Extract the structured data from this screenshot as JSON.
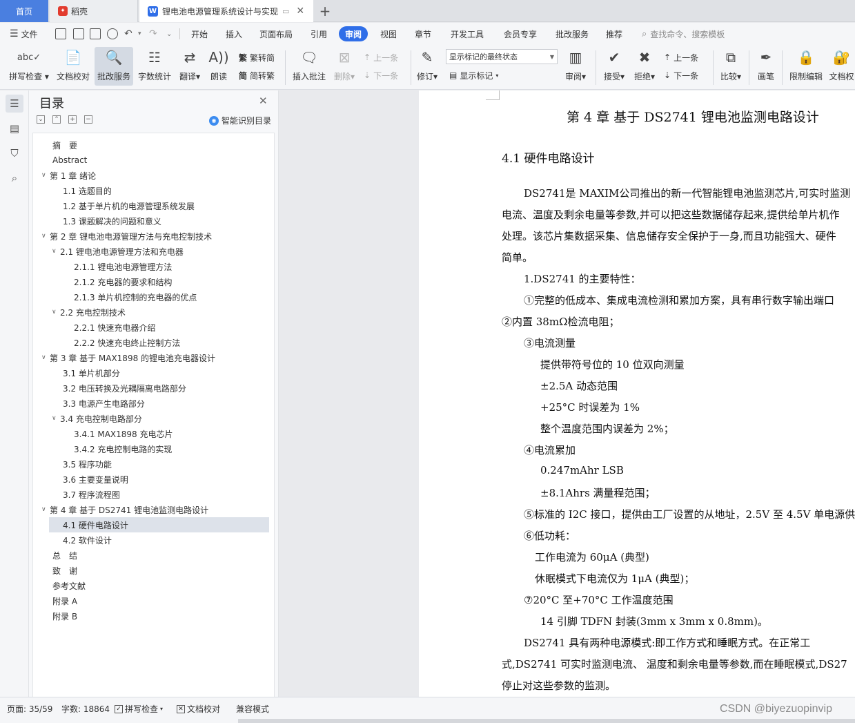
{
  "tabs": {
    "home": "首页",
    "daoke": "稻壳",
    "doc": "锂电池电源管理系统设计与实现"
  },
  "menu": {
    "file": "文件",
    "items": [
      "开始",
      "插入",
      "页面布局",
      "引用",
      "审阅",
      "视图",
      "章节",
      "开发工具",
      "会员专享",
      "批改服务",
      "推荐"
    ],
    "active": "审阅",
    "search_placeholder": "查找命令、搜索模板"
  },
  "ribbon": {
    "spell_check": "拼写检查",
    "doc_proof": "文档校对",
    "review_service": "批改服务",
    "word_count": "字数统计",
    "translate": "翻译",
    "read_aloud": "朗读",
    "to_traditional": "繁转简",
    "to_simplified": "简转繁",
    "insert_comment": "插入批注",
    "delete": "删除",
    "prev_comment": "上一条",
    "next_comment": "下一条",
    "revise": "修订",
    "markup_state": "显示标记的最终状态",
    "show_markup": "显示标记",
    "review": "审阅",
    "accept": "接受",
    "reject": "拒绝",
    "prev_change": "上一条",
    "next_change": "下一条",
    "compare": "比较",
    "pen": "画笔",
    "restrict_edit": "限制编辑",
    "doc_permission": "文档权"
  },
  "toc": {
    "title": "目录",
    "smart_label": "智能识别目录",
    "items": [
      {
        "text": "摘　要",
        "level": 0,
        "chev": ""
      },
      {
        "text": "Abstract",
        "level": 0,
        "chev": ""
      },
      {
        "text": "第 1 章  绪论",
        "level": 0,
        "chev": "v"
      },
      {
        "text": "1.1  选题目的",
        "level": 1,
        "chev": ""
      },
      {
        "text": "1.2  基于单片机的电源管理系统发展",
        "level": 1,
        "chev": ""
      },
      {
        "text": "1.3  课题解决的问题和意义",
        "level": 1,
        "chev": ""
      },
      {
        "text": "第 2 章  锂电池电源管理方法与充电控制技术",
        "level": 0,
        "chev": "v"
      },
      {
        "text": "2.1  锂电池电源管理方法和充电器",
        "level": 1,
        "chev": "v"
      },
      {
        "text": "2.1.1 锂电池电源管理方法",
        "level": 2,
        "chev": ""
      },
      {
        "text": "2.1.2 充电器的要求和结构",
        "level": 2,
        "chev": ""
      },
      {
        "text": "2.1.3 单片机控制的充电器的优点",
        "level": 2,
        "chev": ""
      },
      {
        "text": "2.2  充电控制技术",
        "level": 1,
        "chev": "v"
      },
      {
        "text": "2.2.1  快速充电器介绍",
        "level": 2,
        "chev": ""
      },
      {
        "text": "2.2.2  快速充电终止控制方法",
        "level": 2,
        "chev": ""
      },
      {
        "text": " 第 3 章  基于 MAX1898 的锂电池充电器设计",
        "level": 0,
        "chev": "v"
      },
      {
        "text": "3.1  单片机部分",
        "level": 1,
        "chev": ""
      },
      {
        "text": "3.2  电压转换及光耦隔离电路部分",
        "level": 1,
        "chev": ""
      },
      {
        "text": "3.3  电源产生电路部分",
        "level": 1,
        "chev": ""
      },
      {
        "text": "3.4  充电控制电路部分",
        "level": 1,
        "chev": "v"
      },
      {
        "text": "3.4.1 MAX1898 充电芯片",
        "level": 2,
        "chev": ""
      },
      {
        "text": "3.4.2 充电控制电路的实现",
        "level": 2,
        "chev": ""
      },
      {
        "text": "3.5  程序功能",
        "level": 1,
        "chev": ""
      },
      {
        "text": "3.6  主要变量说明",
        "level": 1,
        "chev": ""
      },
      {
        "text": "3.7  程序流程图",
        "level": 1,
        "chev": ""
      },
      {
        "text": "第 4 章  基于 DS2741 锂电池监测电路设计",
        "level": 0,
        "chev": "v"
      },
      {
        "text": "4.1  硬件电路设计",
        "level": 1,
        "chev": "",
        "selected": true
      },
      {
        "text": "4.2  软件设计",
        "level": 1,
        "chev": ""
      },
      {
        "text": "总　结",
        "level": 0,
        "chev": ""
      },
      {
        "text": "致　谢",
        "level": 0,
        "chev": ""
      },
      {
        "text": "参考文献",
        "level": 0,
        "chev": ""
      },
      {
        "text": "附录 A",
        "level": 0,
        "chev": ""
      },
      {
        "text": "附录 B",
        "level": 0,
        "chev": ""
      }
    ]
  },
  "document": {
    "chapter_title": "第 4 章  基于 DS2741 锂电池监测电路设计",
    "section_title": "4.1  硬件电路设计",
    "lines": [
      "DS2741是 MAXIM公司推出的新一代智能锂电池监测芯片,可实时监测",
      "电流、温度及剩余电量等参数,并可以把这些数据储存起来,提供给单片机作",
      "处理。该芯片集数据采集、信息储存安全保护于一身,而且功能强大、硬件",
      "简单。",
      "1.DS2741 的主要特性：",
      "①完整的低成本、集成电流检测和累加方案，具有串行数字输出端口",
      "②内置 38mΩ检流电阻；",
      "③电流测量",
      "提供带符号位的 10 位双向测量",
      "±2.5A 动态范围",
      "+25°C 时误差为 1%",
      "整个温度范围内误差为 2%；",
      "④电流累加",
      "0.247mAhr LSB",
      "±8.1Ahrs 满量程范围；",
      "⑤标准的 I2C 接口，提供由工厂设置的从地址，2.5V 至 4.5V 单电源供",
      "⑥低功耗：",
      "工作电流为 60μA (典型)",
      "休眠模式下电流仅为 1μA (典型)；",
      "⑦20°C 至+70°C 工作温度范围",
      "14 引脚 TDFN 封装(3mm x 3mm x 0.8mm)。",
      "DS2741 具有两种电源模式:即工作方式和睡眠方式。在正常工",
      "式,DS2741 可实时监测电流、 温度和剩余电量等参数,而在睡眠模式,DS27",
      "停止对这些参数的监测。"
    ]
  },
  "status": {
    "page": "页面: 35/59",
    "words": "字数: 18864",
    "spell": "拼写检查",
    "proof": "文档校对",
    "compat": "兼容模式"
  },
  "watermark": "CSDN @biyezuopinvip"
}
